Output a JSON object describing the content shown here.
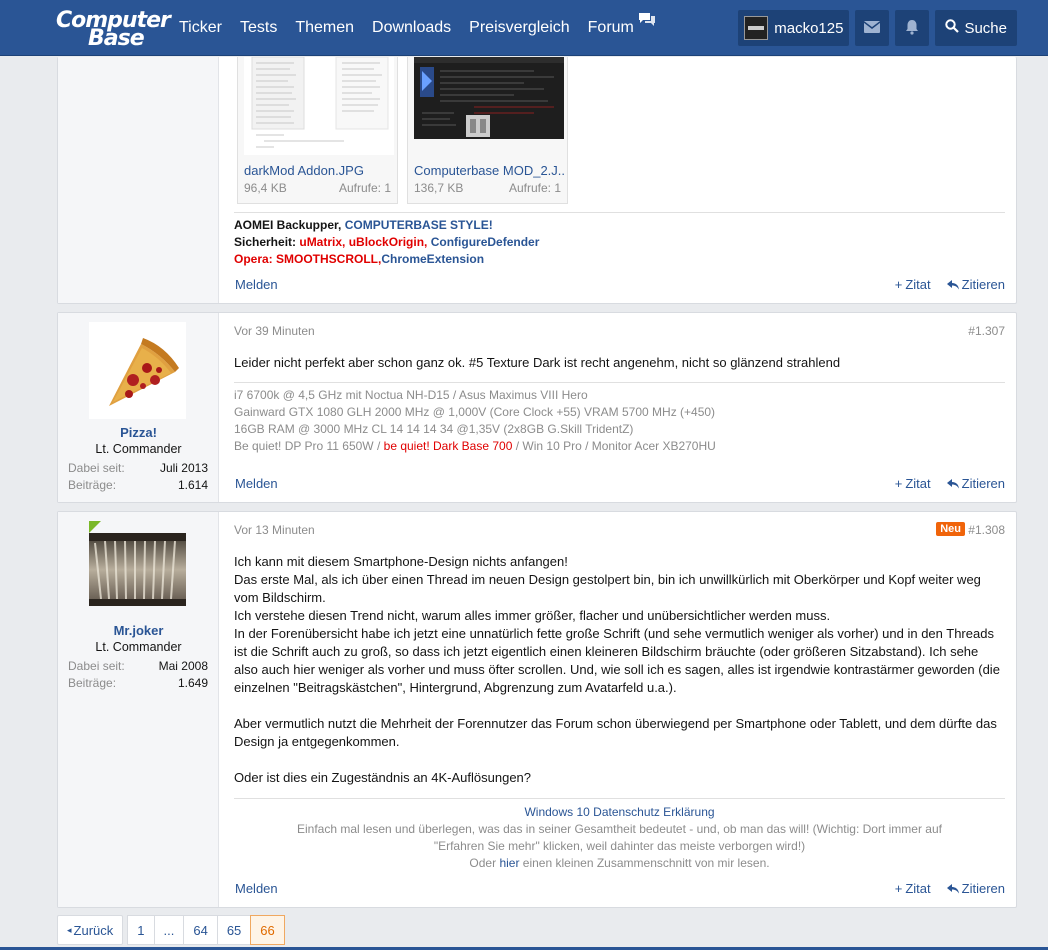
{
  "header": {
    "logo_line1": "Computer",
    "logo_line2": "Base",
    "nav": [
      "Ticker",
      "Tests",
      "Themen",
      "Downloads",
      "Preisvergleich",
      "Forum"
    ],
    "username": "macko125",
    "search_label": "Suche"
  },
  "post1": {
    "attachments": [
      {
        "name": "darkMod Addon.JPG",
        "size": "96,4 KB",
        "views": "Aufrufe: 1"
      },
      {
        "name": "Computerbase MOD_2.J...",
        "size": "136,7 KB",
        "views": "Aufrufe: 1"
      }
    ],
    "sig_l1_a": "AOMEI Backupper, ",
    "sig_l1_b": "COMPUTERBASE STYLE!",
    "sig_l2_a": "Sicherheit: ",
    "sig_l2_b": "uMatrix, uBlockOrigin, ",
    "sig_l2_c": "ConfigureDefender",
    "sig_l3_a": "Opera: SMOOTHSCROLL,",
    "sig_l3_b": "ChromeExtension",
    "report": "Melden",
    "quote": "Zitat",
    "reply": "Zitieren"
  },
  "post2": {
    "user": "Pizza!",
    "title": "Lt. Commander",
    "joined_label": "Dabei seit:",
    "joined": "Juli 2013",
    "posts_label": "Beiträge:",
    "posts": "1.614",
    "time": "Vor 39 Minuten",
    "num": "#1.307",
    "text": "Leider nicht perfekt aber schon ganz ok. #5 Texture Dark ist recht angenehm, nicht so glänzend strahlend",
    "sig": [
      "i7 6700k @ 4,5 GHz mit Noctua NH-D15 / Asus Maximus VIII Hero",
      "Gainward GTX 1080 GLH 2000 MHz @ 1,000V (Core Clock +55) VRAM 5700 MHz (+450)",
      "16GB RAM @ 3000 MHz CL 14 14 14 34 @1,35V (2x8GB G.Skill TridentZ)"
    ],
    "sig4_a": "Be quiet! DP Pro 11 650W / ",
    "sig4_b": "be quiet! Dark Base 700",
    "sig4_c": " / Win 10 Pro / Monitor Acer XB270HU",
    "report": "Melden",
    "quote": "Zitat",
    "reply": "Zitieren"
  },
  "post3": {
    "user": "Mr.joker",
    "title": "Lt. Commander",
    "joined_label": "Dabei seit:",
    "joined": "Mai 2008",
    "posts_label": "Beiträge:",
    "posts": "1.649",
    "time": "Vor 13 Minuten",
    "badge": "Neu",
    "num": "#1.308",
    "p1": "Ich kann mit diesem Smartphone-Design nichts anfangen!",
    "p2": "Das erste Mal, als ich über einen Thread im neuen Design gestolpert bin, bin ich unwillkürlich mit Oberkörper und Kopf weiter weg vom Bildschirm.",
    "p3": "Ich verstehe diesen Trend nicht, warum alles immer größer, flacher und unübersichtlicher werden muss.",
    "p4": "In der Forenübersicht habe ich jetzt eine unnatürlich fette große Schrift (und sehe vermutlich weniger als vorher) und in den Threads ist die Schrift auch zu groß, so dass ich jetzt eigentlich einen kleineren Bildschirm bräuchte (oder größeren Sitzabstand). Ich sehe also auch hier weniger als vorher und muss öfter scrollen. Und, wie soll ich es sagen, alles ist irgendwie kontrastärmer geworden (die einzelnen \"Beitragskästchen\", Hintergrund, Abgrenzung zum Avatarfeld u.a.).",
    "p5": "Aber vermutlich nutzt die Mehrheit der Forennutzer das Forum schon überwiegend per Smartphone oder Tablett, und dem dürfte das Design ja entgegenkommen.",
    "p6": "Oder ist dies ein Zugeständnis an 4K-Auflösungen?",
    "sig_link": "Windows 10 Datenschutz Erklärung",
    "sig_text": "Einfach mal lesen und überlegen, was das in seiner Gesamtheit bedeutet - und, ob man das will! (Wichtig: Dort immer auf \"Erfahren Sie mehr\" klicken, weil dahinter das meiste verborgen wird!)",
    "sig_last_a": "Oder ",
    "sig_last_b": "hier",
    "sig_last_c": " einen kleinen Zusammenschnitt von mir lesen.",
    "report": "Melden",
    "quote": "Zitat",
    "reply": "Zitieren"
  },
  "pagination": {
    "prev": "Zurück",
    "pages": [
      "1",
      "...",
      "64",
      "65"
    ],
    "current": "66"
  },
  "colors": {
    "brand": "#2a5595",
    "red": "#e00000",
    "new_badge": "#f0640a"
  }
}
